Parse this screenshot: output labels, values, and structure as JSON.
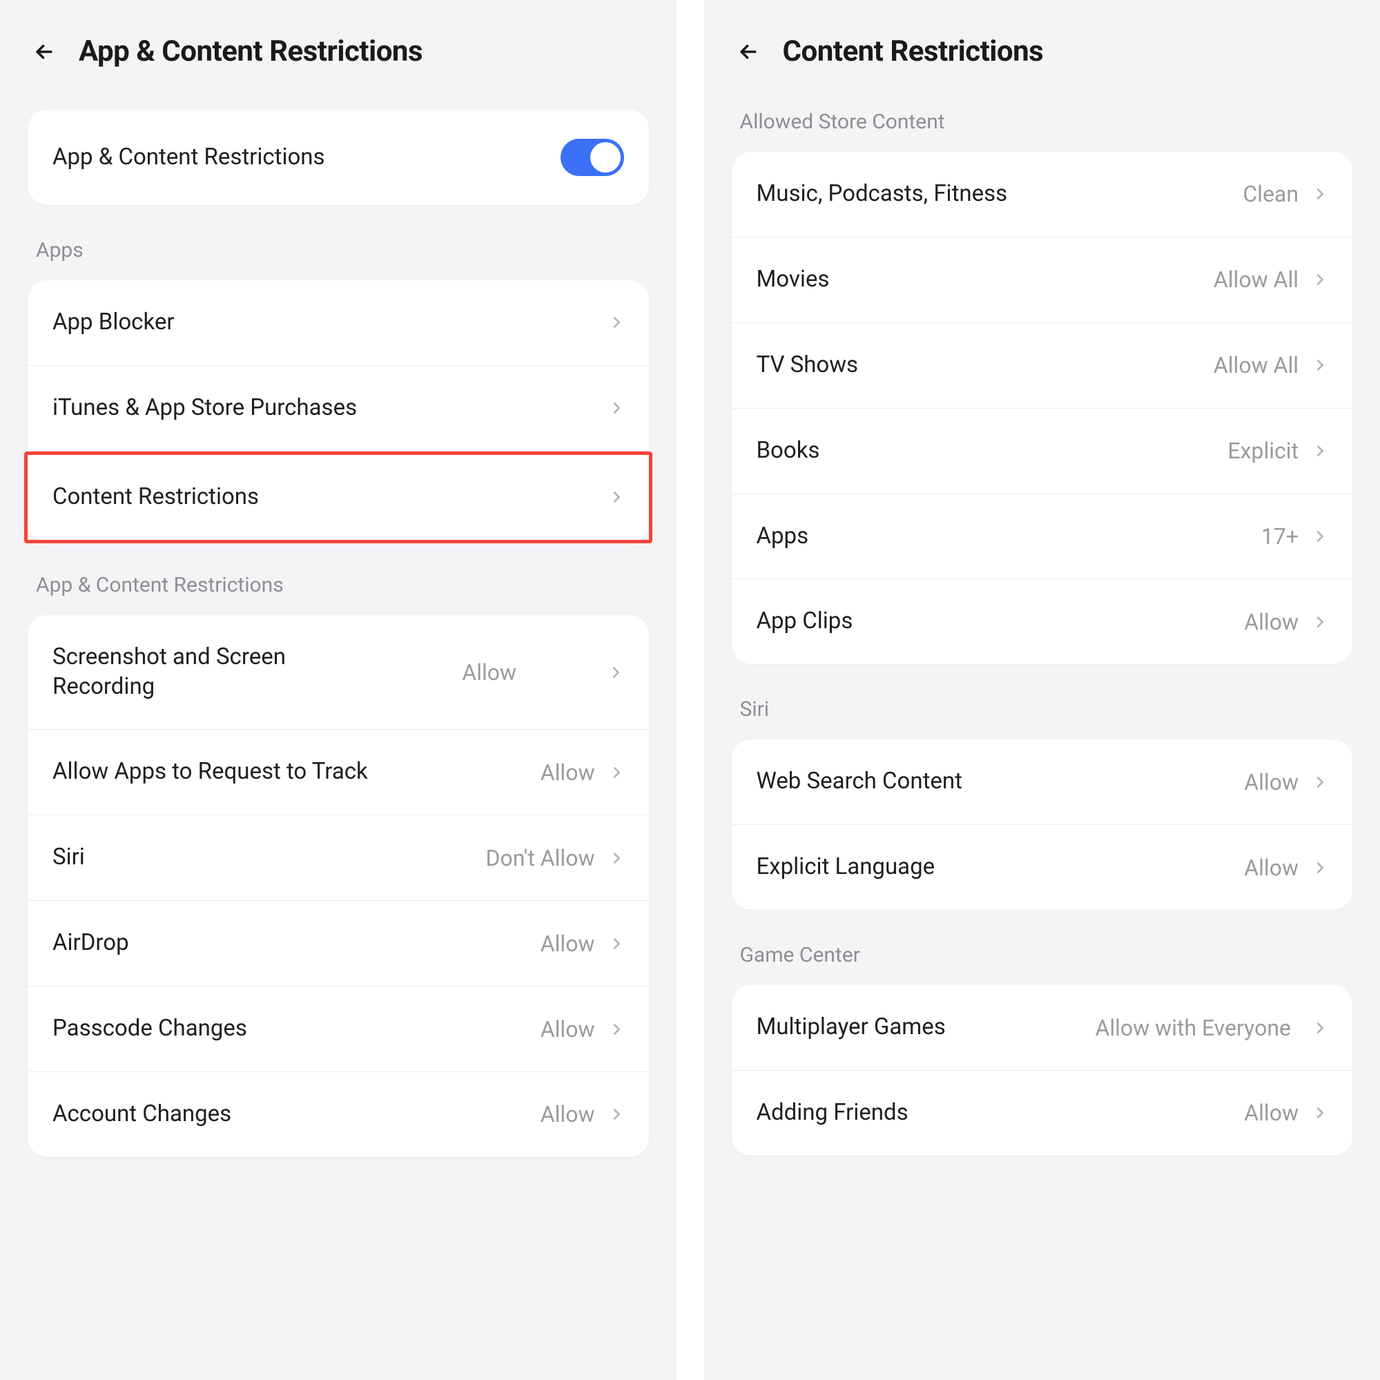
{
  "left": {
    "title": "App & Content Restrictions",
    "toggle_label": "App & Content Restrictions",
    "sections": {
      "apps": {
        "label": "Apps",
        "items": [
          {
            "label": "App Blocker"
          },
          {
            "label": "iTunes & App Store Purchases"
          },
          {
            "label": "Content Restrictions"
          }
        ]
      },
      "restrictions": {
        "label": "App & Content Restrictions",
        "items": [
          {
            "label": "Screenshot and Screen Recording",
            "value": "Allow"
          },
          {
            "label": "Allow Apps to Request to Track",
            "value": "Allow"
          },
          {
            "label": "Siri",
            "value": "Don't Allow"
          },
          {
            "label": "AirDrop",
            "value": "Allow"
          },
          {
            "label": "Passcode Changes",
            "value": "Allow"
          },
          {
            "label": "Account Changes",
            "value": "Allow"
          }
        ]
      }
    }
  },
  "right": {
    "title": "Content Restrictions",
    "sections": {
      "store": {
        "label": "Allowed Store Content",
        "items": [
          {
            "label": "Music, Podcasts, Fitness",
            "value": "Clean"
          },
          {
            "label": "Movies",
            "value": "Allow All"
          },
          {
            "label": "TV Shows",
            "value": "Allow All"
          },
          {
            "label": "Books",
            "value": "Explicit"
          },
          {
            "label": "Apps",
            "value": "17+"
          },
          {
            "label": "App Clips",
            "value": "Allow"
          }
        ]
      },
      "siri": {
        "label": "Siri",
        "items": [
          {
            "label": "Web Search Content",
            "value": "Allow"
          },
          {
            "label": "Explicit Language",
            "value": "Allow"
          }
        ]
      },
      "gamecenter": {
        "label": "Game Center",
        "items": [
          {
            "label": "Multiplayer Games",
            "value": "Allow with Everyone"
          },
          {
            "label": "Adding Friends",
            "value": "Allow"
          }
        ]
      }
    }
  }
}
